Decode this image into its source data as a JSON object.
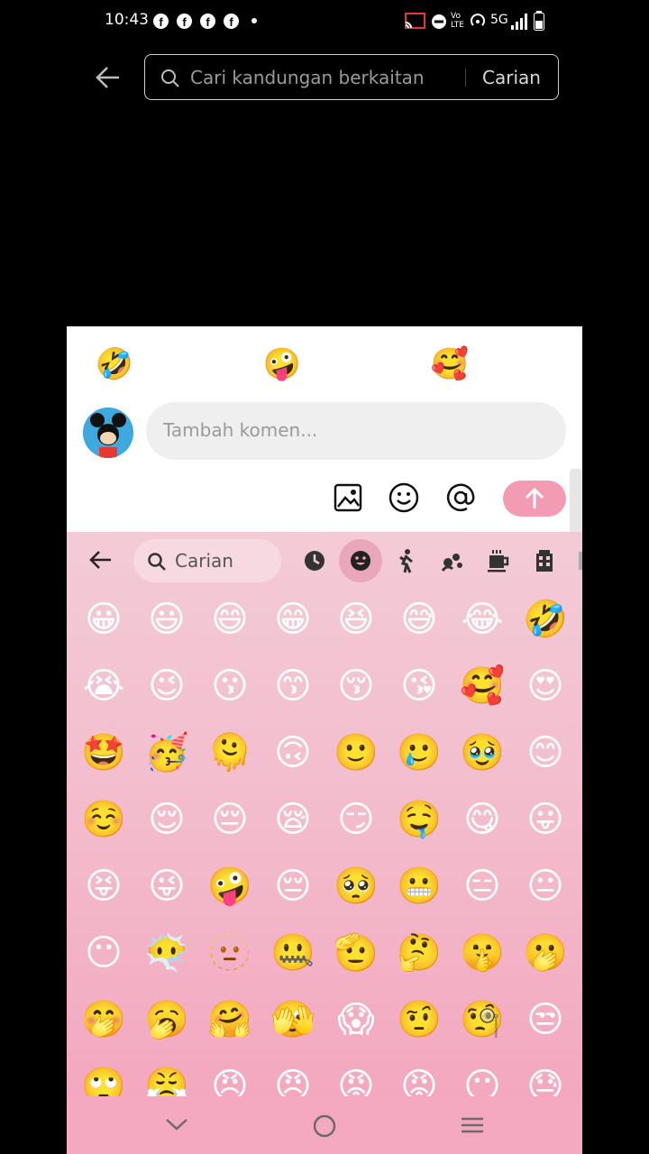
{
  "status_bar": {
    "time": "10:43",
    "network": "5G",
    "fb_letter": "f"
  },
  "search": {
    "placeholder": "Cari kandungan berkaitan",
    "button_label": "Carian"
  },
  "comment": {
    "quick_emojis": [
      "🤣",
      "😡",
      "🤪",
      "😁",
      "🥰",
      "😂"
    ],
    "input_placeholder": "Tambah komen...",
    "tools": [
      "image-icon",
      "emoji-icon",
      "mention-icon"
    ],
    "send_label": "↑",
    "send_color": "#f49bb4"
  },
  "emoji_keyboard": {
    "search_label": "Carian",
    "categories": [
      "recent",
      "smileys",
      "people",
      "animals",
      "food",
      "travel"
    ],
    "selected_category": "smileys",
    "rows": [
      [
        "😀",
        "😃",
        "😄",
        "😁",
        "😆",
        "😅",
        "😂",
        "🤣"
      ],
      [
        "😭",
        "😉",
        "😗",
        "😙",
        "😚",
        "😘",
        "🥰",
        "😍"
      ],
      [
        "🤩",
        "🥳",
        "🫠",
        "🙃",
        "🙂",
        "🥲",
        "🥹",
        "😊"
      ],
      [
        "☺️",
        "😌",
        "😔",
        "😪",
        "😏",
        "🤤",
        "😋",
        "😛"
      ],
      [
        "😝",
        "😜",
        "🤪",
        "😔",
        "🥺",
        "😬",
        "😑",
        "😐"
      ],
      [
        "😶",
        "😶‍🌫️",
        "🫥",
        "🤐",
        "🫡",
        "🤔",
        "🤫",
        "🫢"
      ],
      [
        "🤭",
        "🥱",
        "🤗",
        "🫣",
        "😱",
        "🤨",
        "🧐",
        "😒"
      ],
      [
        "🙄",
        "😤",
        "😠",
        "😠",
        "😡",
        "😡",
        "😶",
        "😓"
      ]
    ]
  },
  "nav": {
    "back": "chevron-down-icon",
    "home": "circle-home-icon",
    "recents": "menu-icon"
  }
}
